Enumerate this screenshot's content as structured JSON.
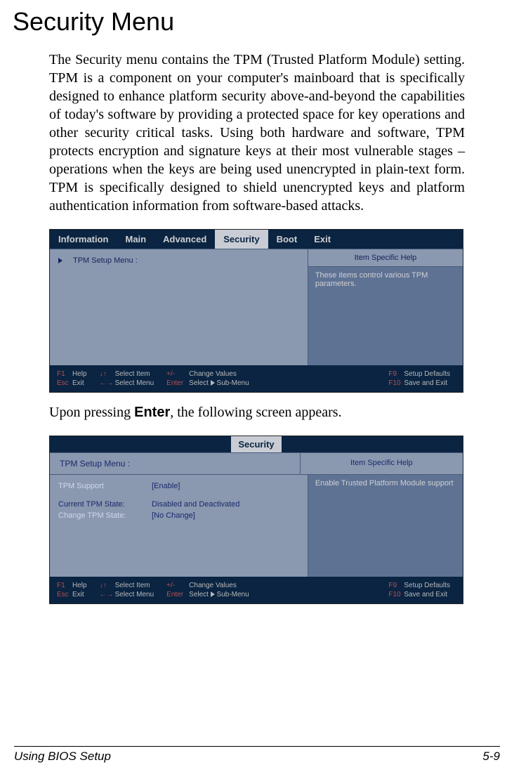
{
  "page": {
    "title": "Security Menu",
    "intro_paragraph": "The Security menu contains the TPM (Trusted Platform Module) setting. TPM is a component on your computer's mainboard that is specifically designed to enhance platform security above-and-beyond the capabilities of today's software by providing a protected space for key operations and other security critical tasks. Using both hardware and software, TPM protects encryption and signature keys at their most vulnerable stages – operations when the keys are being used unencrypted in plain-text form. TPM is specifically designed to shield unencrypted keys and platform authentication information from software-based attacks.",
    "mid_sentence_pre": "Upon pressing ",
    "mid_sentence_key": "Enter",
    "mid_sentence_post": ", the following screen appears.",
    "footer_left": "Using BIOS Setup",
    "footer_right": "5-9"
  },
  "screen1": {
    "tabs": [
      "Information",
      "Main",
      "Advanced",
      "Security",
      "Boot",
      "Exit"
    ],
    "active_tab": "Security",
    "left_item": "TPM Setup Menu :",
    "help_title": "Item Specific Help",
    "help_text": "These items control various TPM parameters.",
    "footer": {
      "f1": "F1",
      "f1_label": "Help",
      "esc": "Esc",
      "esc_label": "Exit",
      "arrows_v": "↓↑",
      "select_item": "Select Item",
      "arrows_h": "←→",
      "select_menu": "Select Menu",
      "pm": "+/-",
      "change_values": "Change Values",
      "enter": "Enter",
      "select_sub_pre": "Select ",
      "select_sub_post": " Sub-Menu",
      "f9": "F9",
      "f9_label": "Setup Defaults",
      "f10": "F10",
      "f10_label": "Save and Exit"
    }
  },
  "screen2": {
    "tab": "Security",
    "subtitle_left": "TPM Setup Menu :",
    "help_title": "Item Specific Help",
    "help_text": "Enable Trusted Platform Module support",
    "fields": {
      "tpm_support_label": "TPM Support",
      "tpm_support_value": "[Enable]",
      "current_state_label": "Current TPM State:",
      "current_state_value": "Disabled and Deactivated",
      "change_state_label": "Change TPM State:",
      "change_state_value": "[No Change]"
    },
    "footer": {
      "f1": "F1",
      "f1_label": "Help",
      "esc": "Esc",
      "esc_label": "Exit",
      "arrows_v": "↓↑",
      "select_item": "Select Item",
      "arrows_h": "←→",
      "select_menu": "Select Menu",
      "pm": "+/-",
      "change_values": "Change Values",
      "enter": "Enter",
      "select_sub_pre": "Select ",
      "select_sub_post": " Sub-Menu",
      "f9": "F9",
      "f9_label": "Setup Defaults",
      "f10": "F10",
      "f10_label": "Save and Exit"
    }
  }
}
